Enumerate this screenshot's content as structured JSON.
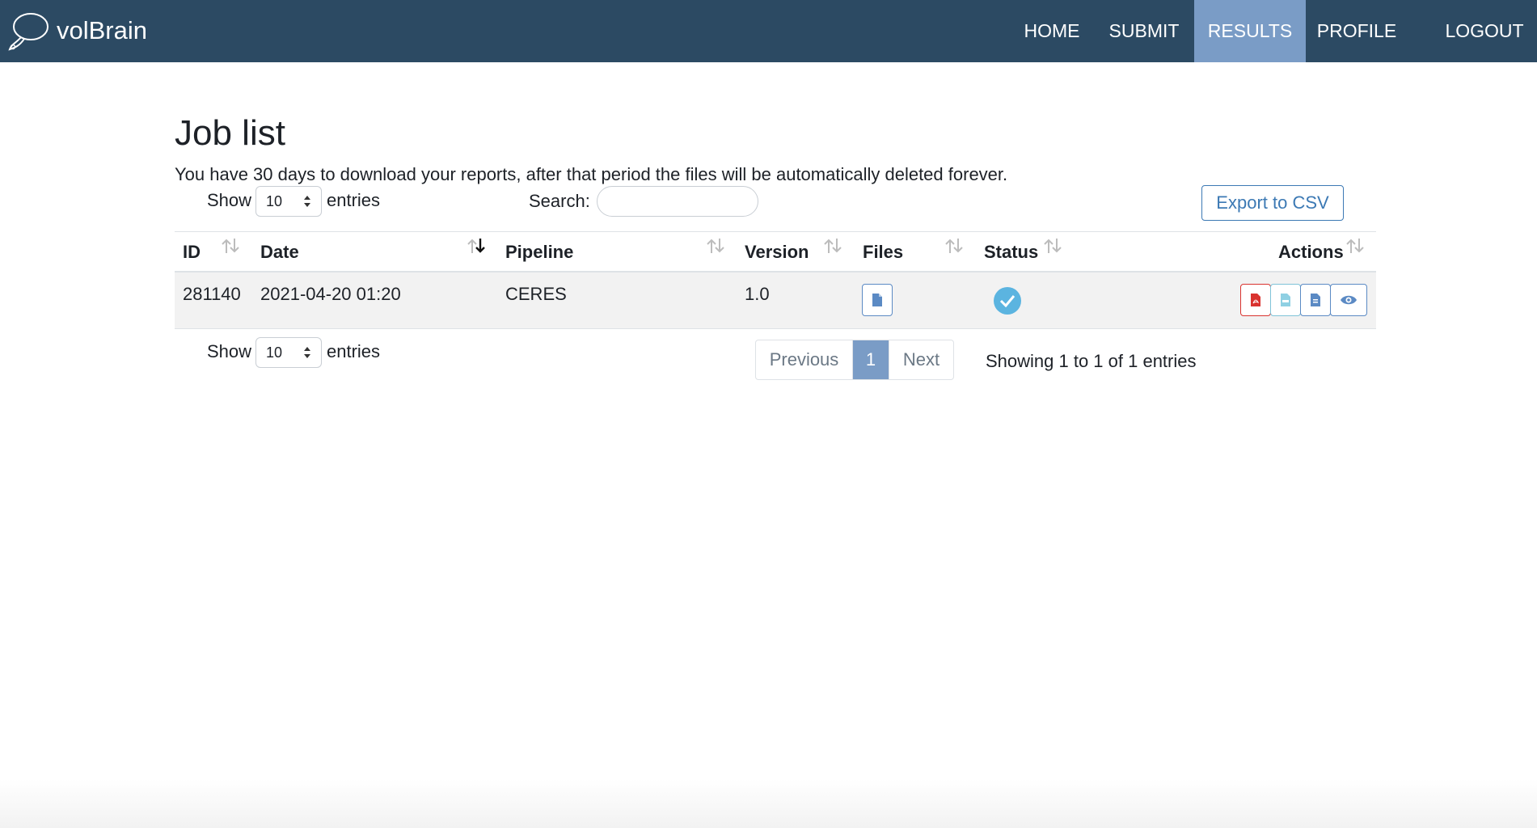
{
  "brand": {
    "name": "volBrain",
    "logo_icon": "speech-bubble-icon"
  },
  "nav": {
    "items": [
      {
        "label": "HOME",
        "active": false
      },
      {
        "label": "SUBMIT",
        "active": false
      },
      {
        "label": "RESULTS",
        "active": true
      },
      {
        "label": "PROFILE",
        "active": false
      },
      {
        "label": "LOGOUT",
        "active": false
      }
    ]
  },
  "page": {
    "title": "Job list",
    "notice": "You have 30 days to download your reports, after that period the files will be automatically deleted forever."
  },
  "controls": {
    "show_label": "Show",
    "entries_label": "entries",
    "page_size": "10",
    "search_label": "Search:",
    "search_value": "",
    "export_label": "Export to CSV"
  },
  "table": {
    "columns": [
      "ID",
      "Date",
      "Pipeline",
      "Version",
      "Files",
      "Status",
      "Actions"
    ],
    "sorted_column": "Date",
    "sort_direction": "descending",
    "rows": [
      {
        "id": "281140",
        "date": "2021-04-20 01:20",
        "pipeline": "CERES",
        "version": "1.0",
        "files_icon": "file-icon",
        "status_icon": "check-circle-icon",
        "actions": [
          "pdf-icon",
          "csv-icon",
          "file-icon",
          "eye-icon"
        ]
      }
    ]
  },
  "pagination": {
    "previous_label": "Previous",
    "current_page": "1",
    "next_label": "Next",
    "info": "Showing 1 to 1 of 1 entries"
  },
  "colors": {
    "navbar": "#2c4a63",
    "nav_active": "#7a9cc6",
    "primary_outline": "#3c79b4",
    "danger": "#d9332f",
    "info": "#7fc3d8",
    "status_ok": "#5bb4e0"
  }
}
